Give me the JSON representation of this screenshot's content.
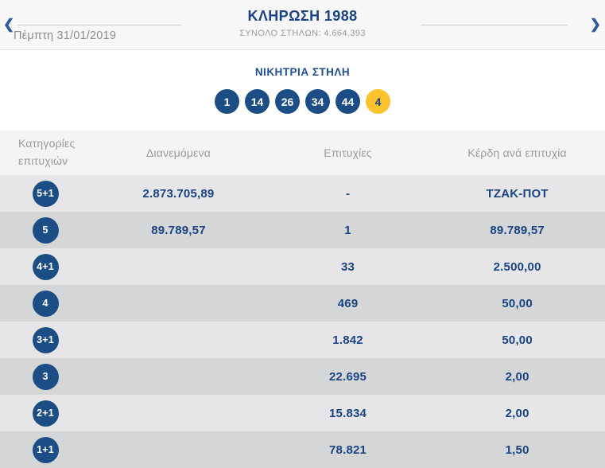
{
  "colors": {
    "primary_blue": "#1a4382",
    "ball_blue": "#1c4e85",
    "bonus_yellow": "#fcc32d",
    "muted_gray": "#9b9b9c",
    "row_light": "#e6e6e8",
    "row_dark": "#d5d6d8"
  },
  "nav": {
    "title": "ΚΛΗΡΩΣΗ 1988",
    "total_columns_label": "ΣΥΝΟΛΟ ΣΤΗΛΩΝ: 4.664.393",
    "date": "Πέμπτη 31/01/2019",
    "prev_icon": "❮",
    "next_icon": "❯"
  },
  "winning_column": {
    "title": "ΝΙΚΗΤΡΙΑ ΣΤΗΛΗ",
    "numbers": [
      "1",
      "14",
      "26",
      "34",
      "44"
    ],
    "bonus_number": "4"
  },
  "results_table": {
    "headers": {
      "category": "Κατηγορίες επιτυχιών",
      "distributed": "Διανεμόμενα",
      "winners": "Επιτυχίες",
      "prize_per_winner": "Κέρδη ανά επιτυχία"
    },
    "rows": [
      {
        "category": "5+1",
        "distributed": "2.873.705,89",
        "winners": "-",
        "prize": "ΤΖΑΚ-ΠΟΤ"
      },
      {
        "category": "5",
        "distributed": "89.789,57",
        "winners": "1",
        "prize": "89.789,57"
      },
      {
        "category": "4+1",
        "distributed": "",
        "winners": "33",
        "prize": "2.500,00"
      },
      {
        "category": "4",
        "distributed": "",
        "winners": "469",
        "prize": "50,00"
      },
      {
        "category": "3+1",
        "distributed": "",
        "winners": "1.842",
        "prize": "50,00"
      },
      {
        "category": "3",
        "distributed": "",
        "winners": "22.695",
        "prize": "2,00"
      },
      {
        "category": "2+1",
        "distributed": "",
        "winners": "15.834",
        "prize": "2,00"
      },
      {
        "category": "1+1",
        "distributed": "",
        "winners": "78.821",
        "prize": "1,50"
      }
    ]
  }
}
